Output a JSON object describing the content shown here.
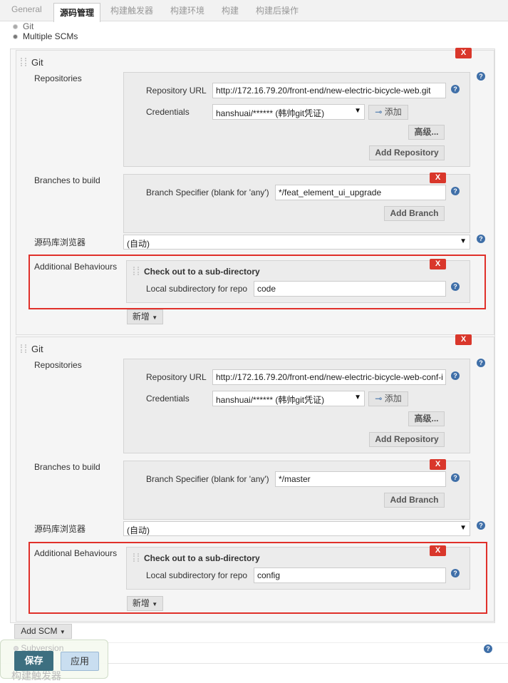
{
  "tabs": [
    "General",
    "源码管理",
    "构建触发器",
    "构建环境",
    "构建",
    "构建后操作"
  ],
  "scm_options": {
    "git": "Git",
    "multiple": "Multiple SCMs",
    "subversion": "Subversion"
  },
  "scms": [
    {
      "title": "Git",
      "repositories_label": "Repositories",
      "repo_url_label": "Repository URL",
      "repo_url": "http://172.16.79.20/front-end/new-electric-bicycle-web.git",
      "credentials_label": "Credentials",
      "credentials": "hanshuai/****** (韩帅git凭证)",
      "add_label": "添加",
      "advanced_label": "高级...",
      "add_repository_label": "Add Repository",
      "branches_label": "Branches to build",
      "branch_spec_label": "Branch Specifier (blank for 'any')",
      "branch_spec": "*/feat_element_ui_upgrade",
      "add_branch_label": "Add Branch",
      "browser_label": "源码库浏览器",
      "browser": "(自动)",
      "behaviours_label": "Additional Behaviours",
      "behaviour_title": "Check out to a sub-directory",
      "subdir_label": "Local subdirectory for repo",
      "subdir": "code",
      "new_label": "新增"
    },
    {
      "title": "Git",
      "repositories_label": "Repositories",
      "repo_url_label": "Repository URL",
      "repo_url": "http://172.16.79.20/front-end/new-electric-bicycle-web-conf-i",
      "credentials_label": "Credentials",
      "credentials": "hanshuai/****** (韩帅git凭证)",
      "add_label": "添加",
      "advanced_label": "高级...",
      "add_repository_label": "Add Repository",
      "branches_label": "Branches to build",
      "branch_spec_label": "Branch Specifier (blank for 'any')",
      "branch_spec": "*/master",
      "add_branch_label": "Add Branch",
      "browser_label": "源码库浏览器",
      "browser": "(自动)",
      "behaviours_label": "Additional Behaviours",
      "behaviour_title": "Check out to a sub-directory",
      "subdir_label": "Local subdirectory for repo",
      "subdir": "config",
      "new_label": "新增"
    }
  ],
  "delete_label": "X",
  "help_label": "?",
  "add_scm_label": "Add SCM",
  "footer": {
    "save": "保存",
    "apply": "应用",
    "next_section": "构建触发器"
  },
  "colors": {
    "highlight": "#e0302a",
    "delete": "#d9372b",
    "save": "#3d6f80"
  }
}
